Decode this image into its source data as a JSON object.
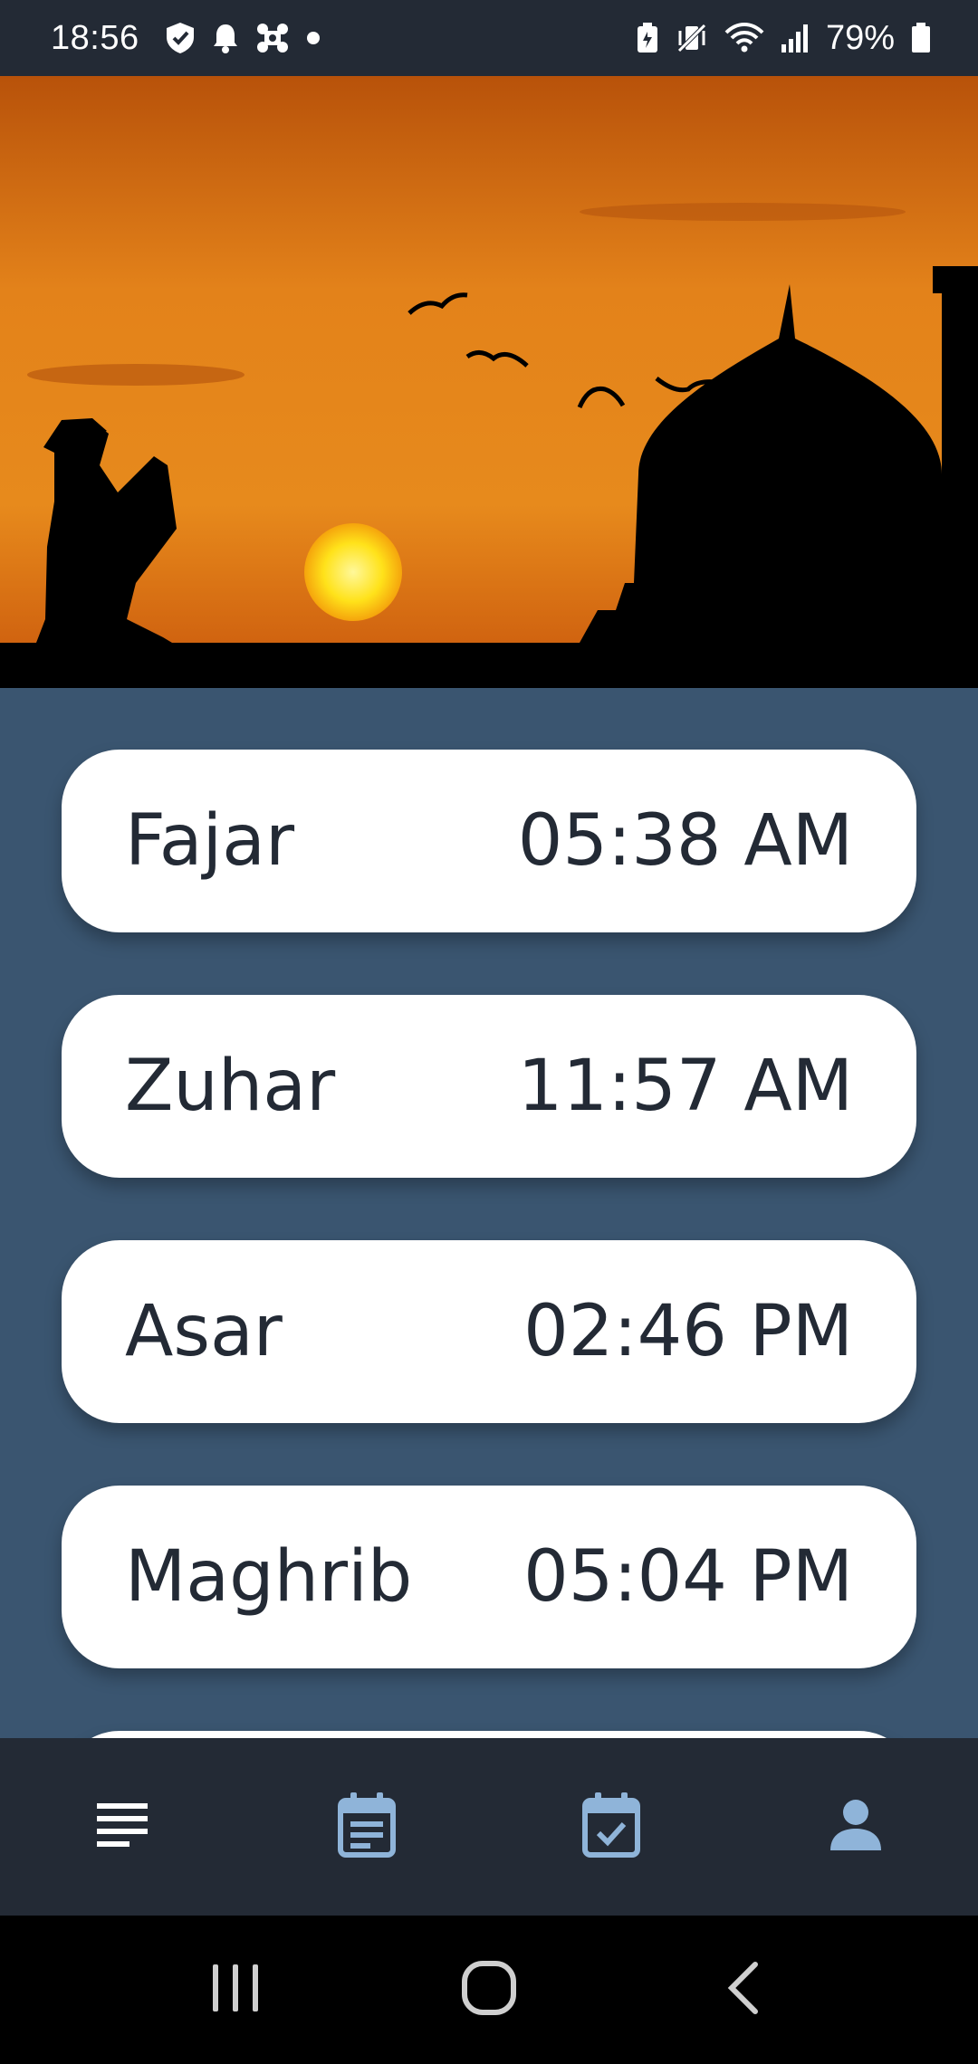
{
  "status_bar": {
    "time": "18:56",
    "battery_percent": "79%",
    "left_icons": [
      "shield-check-icon",
      "bell-icon",
      "network-cross-icon",
      "dot-icon"
    ],
    "right_icons": [
      "battery-saver-icon",
      "vibrate-mute-icon",
      "wifi-icon",
      "signal-icon",
      "battery-icon"
    ]
  },
  "hero": {
    "image": "sunset-mosque-prayer-silhouette"
  },
  "prayers": [
    {
      "name": "Fajar",
      "time": "05:38 AM"
    },
    {
      "name": "Zuhar",
      "time": "11:57 AM"
    },
    {
      "name": "Asar",
      "time": "02:46 PM"
    },
    {
      "name": "Maghrib",
      "time": "05:04 PM"
    }
  ],
  "bottom_nav": {
    "items": [
      {
        "icon": "list-icon"
      },
      {
        "icon": "calendar-notes-icon"
      },
      {
        "icon": "calendar-check-icon"
      },
      {
        "icon": "profile-icon"
      }
    ]
  },
  "system_nav": {
    "items": [
      "recent-apps-icon",
      "home-icon",
      "back-icon"
    ]
  },
  "colors": {
    "background": "#3a5570",
    "bar": "#232a35",
    "card": "#ffffff",
    "text": "#232a35",
    "nav_icon": "#8fb4d9"
  }
}
